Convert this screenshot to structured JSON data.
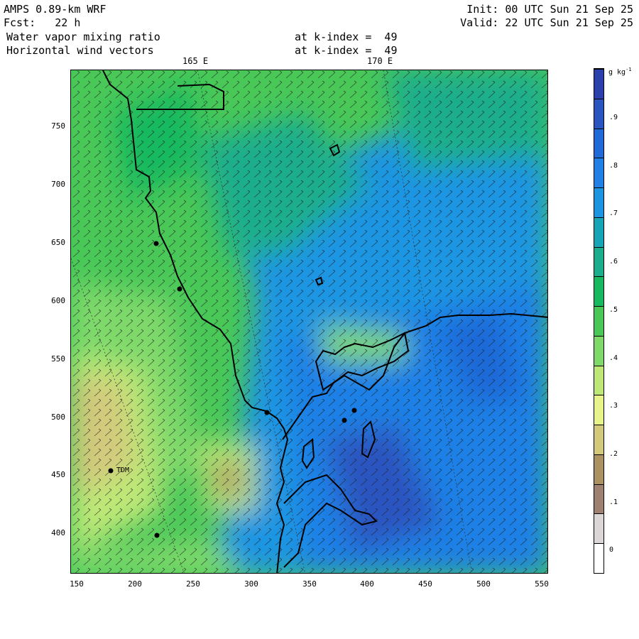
{
  "header": {
    "model": "AMPS 0.89-km WRF",
    "forecast": "Fcst:   22 h",
    "init": "Init: 00 UTC Sun 21 Sep 25",
    "valid": "Valid: 22 UTC Sun 21 Sep 25",
    "field1": "Water vapor mixing ratio",
    "field2": "Horizontal wind vectors",
    "level1": "at k-index =  49",
    "level2": "at k-index =  49"
  },
  "map": {
    "lon_labels": [
      "165 E",
      "170 E"
    ],
    "station_label": "TDM",
    "y_ticks": [
      "750",
      "700",
      "650",
      "600",
      "550",
      "500",
      "450",
      "400"
    ],
    "x_ticks": [
      "150",
      "200",
      "250",
      "300",
      "350",
      "400",
      "450",
      "500",
      "550"
    ]
  },
  "colorbar": {
    "units": "g kg",
    "units_exp": "-1",
    "labels": [
      ".9",
      ".8",
      ".7",
      ".6",
      ".5",
      ".4",
      ".3",
      ".2",
      ".1",
      "0"
    ],
    "colors": [
      "#ffffff",
      "#dcd6d6",
      "#9e8170",
      "#ab9260",
      "#d3c97c",
      "#e8f48a",
      "#bde877",
      "#7ed96a",
      "#49c858",
      "#17b95f",
      "#1bae8c",
      "#17a4b4",
      "#1b95e2",
      "#1f80e6",
      "#1f69d8",
      "#2a54c0",
      "#2a40ac"
    ]
  }
}
